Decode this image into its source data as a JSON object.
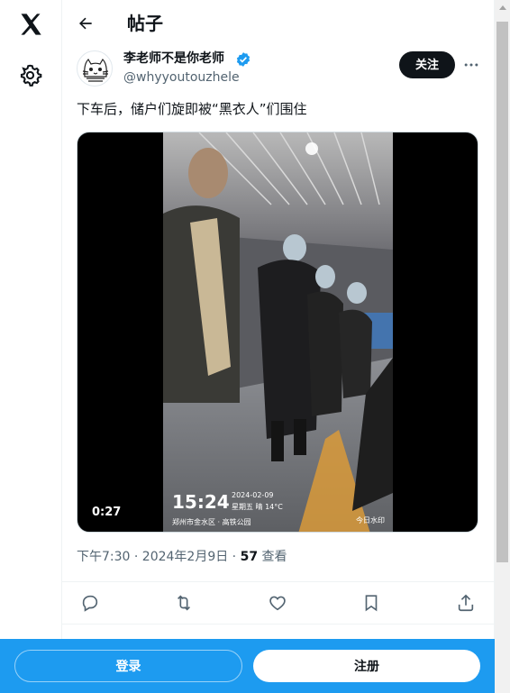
{
  "nav": {
    "logo_icon": "x-logo-icon",
    "settings_icon": "gear-icon"
  },
  "header": {
    "back_icon": "arrow-left-icon",
    "title": "帖子"
  },
  "post": {
    "author_name": "李老师不是你老师",
    "author_handle": "@whyyoutouzhele",
    "verified_icon": "verified-badge-icon",
    "follow_label": "关注",
    "more_icon": "more-icon",
    "text": "下车后，储户们旋即被“黑衣人”们围住",
    "video": {
      "duration": "0:27",
      "overlay_time": "15:24",
      "overlay_date": "2024-02-09",
      "overlay_weekday": "星期五 晴 14°C",
      "overlay_location": "郑州市金水区 · 高铁公园",
      "watermark": "今日水印"
    },
    "timestamp": "下午7:30 · 2024年2月9日 · ",
    "views_count": "57",
    "views_label": " 查看"
  },
  "actions": [
    {
      "name": "reply",
      "icon": "reply-icon"
    },
    {
      "name": "repost",
      "icon": "repost-icon"
    },
    {
      "name": "like",
      "icon": "heart-icon"
    },
    {
      "name": "bookmark",
      "icon": "bookmark-icon"
    },
    {
      "name": "share",
      "icon": "share-icon"
    }
  ],
  "bottom_bar": {
    "login_label": "登录",
    "signup_label": "注册"
  },
  "colors": {
    "brand": "#1d9bf0",
    "text": "#0f1419",
    "muted": "#536471"
  }
}
